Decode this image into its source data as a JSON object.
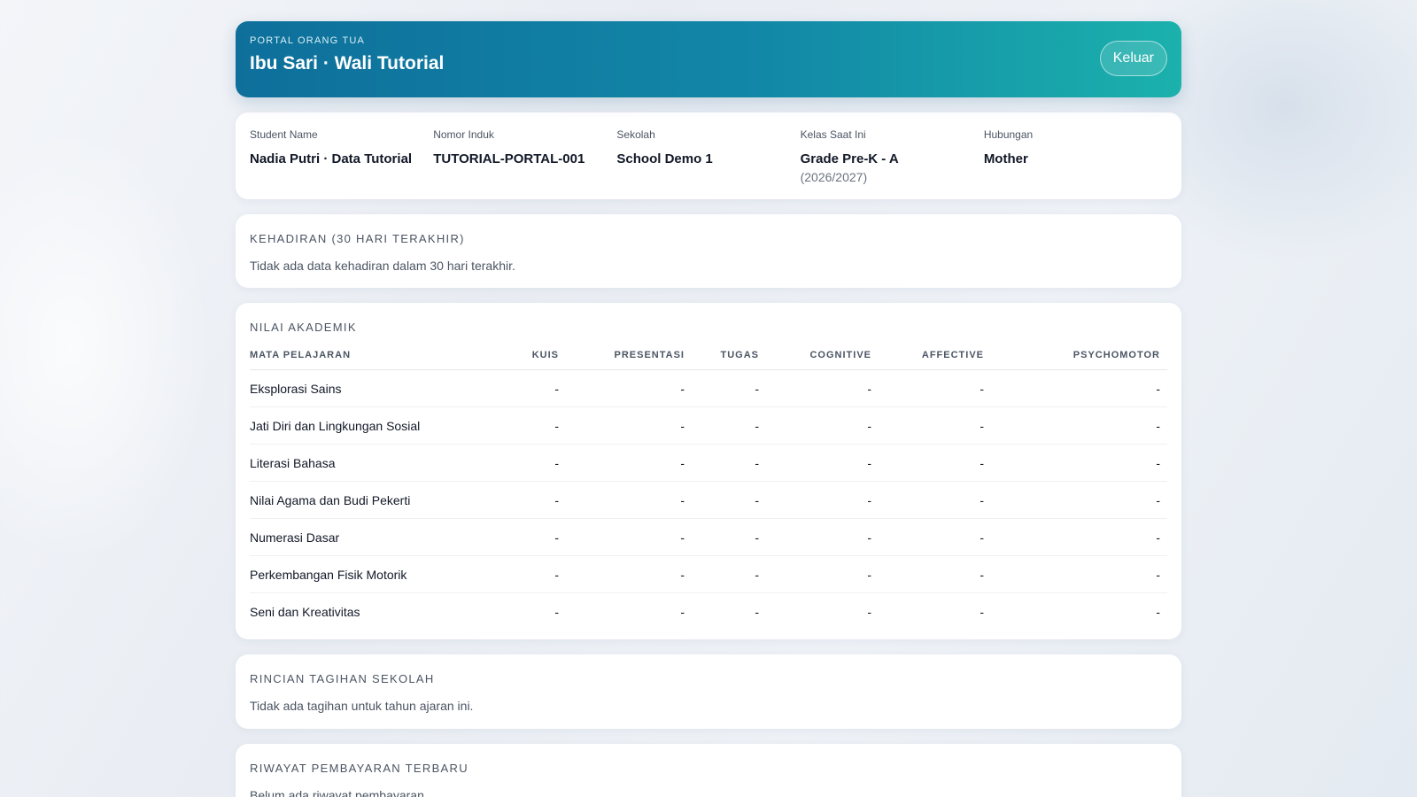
{
  "header": {
    "kicker": "PORTAL ORANG TUA",
    "title": "Ibu Sari · Wali Tutorial",
    "logout_label": "Keluar"
  },
  "student": {
    "name_label": "Student Name",
    "name_value": "Nadia Putri · Data Tutorial",
    "nis_label": "Nomor Induk",
    "nis_value": "TUTORIAL-PORTAL-001",
    "school_label": "Sekolah",
    "school_value": "School Demo 1",
    "class_label": "Kelas Saat Ini",
    "class_value": "Grade Pre-K - A",
    "class_year": "(2026/2027)",
    "relation_label": "Hubungan",
    "relation_value": "Mother"
  },
  "attendance": {
    "title": "KEHADIRAN (30 HARI TERAKHIR)",
    "empty": "Tidak ada data kehadiran dalam 30 hari terakhir."
  },
  "grades": {
    "title": "NILAI AKADEMIK",
    "columns": [
      "MATA PELAJARAN",
      "KUIS",
      "PRESENTASI",
      "TUGAS",
      "COGNITIVE",
      "AFFECTIVE",
      "PSYCHOMOTOR"
    ],
    "rows": [
      {
        "subject": "Eksplorasi Sains",
        "values": [
          "-",
          "-",
          "-",
          "-",
          "-",
          "-"
        ]
      },
      {
        "subject": "Jati Diri dan Lingkungan Sosial",
        "values": [
          "-",
          "-",
          "-",
          "-",
          "-",
          "-"
        ]
      },
      {
        "subject": "Literasi Bahasa",
        "values": [
          "-",
          "-",
          "-",
          "-",
          "-",
          "-"
        ]
      },
      {
        "subject": "Nilai Agama dan Budi Pekerti",
        "values": [
          "-",
          "-",
          "-",
          "-",
          "-",
          "-"
        ]
      },
      {
        "subject": "Numerasi Dasar",
        "values": [
          "-",
          "-",
          "-",
          "-",
          "-",
          "-"
        ]
      },
      {
        "subject": "Perkembangan Fisik Motorik",
        "values": [
          "-",
          "-",
          "-",
          "-",
          "-",
          "-"
        ]
      },
      {
        "subject": "Seni dan Kreativitas",
        "values": [
          "-",
          "-",
          "-",
          "-",
          "-",
          "-"
        ]
      }
    ]
  },
  "billing": {
    "title": "RINCIAN TAGIHAN SEKOLAH",
    "empty": "Tidak ada tagihan untuk tahun ajaran ini."
  },
  "payments": {
    "title": "RIWAYAT PEMBAYARAN TERBARU",
    "empty": "Belum ada riwayat pembayaran."
  }
}
